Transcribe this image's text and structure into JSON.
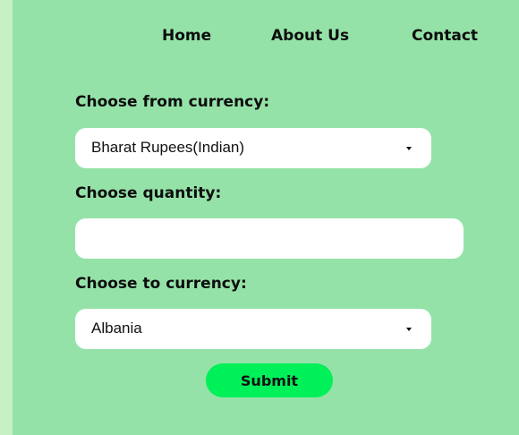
{
  "nav": {
    "home": "Home",
    "about": "About Us",
    "contact": "Contact"
  },
  "form": {
    "from_label": "Choose from currency:",
    "from_value": "Bharat Rupees(Indian)",
    "quantity_label": "Choose quantity:",
    "quantity_value": "",
    "to_label": "Choose to currency:",
    "to_value": "Albania",
    "submit_label": "Submit"
  },
  "colors": {
    "page_background": "#d9f7d9",
    "panel_background": "#95e2a8",
    "submit_button": "#00f05a",
    "field_background": "#ffffff",
    "text": "#0d0d0d"
  },
  "icons": {
    "dropdown": "caret-down-icon"
  }
}
